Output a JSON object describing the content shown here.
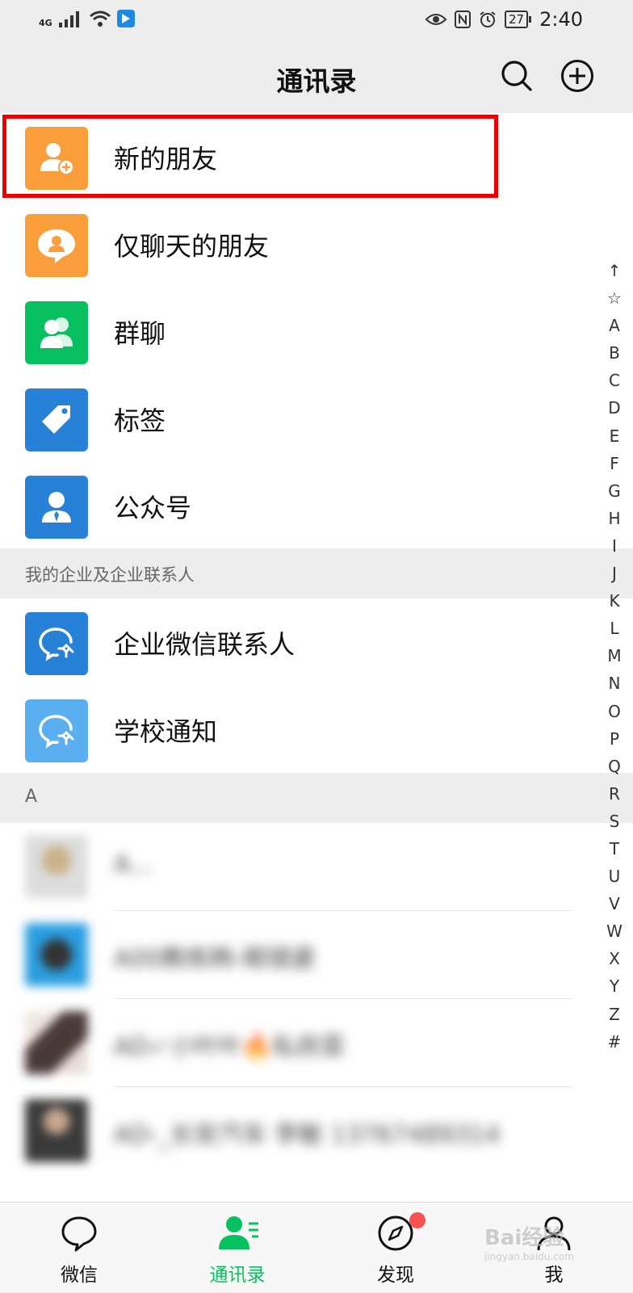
{
  "status_bar": {
    "network": "4G",
    "battery": "27",
    "time": "2:40"
  },
  "header": {
    "title": "通讯录"
  },
  "features": [
    {
      "label": "新的朋友",
      "color": "#fa9d3b",
      "icon": "add-friend-icon"
    },
    {
      "label": "仅聊天的朋友",
      "color": "#fa9d3b",
      "icon": "chat-only-friend-icon"
    },
    {
      "label": "群聊",
      "color": "#07c160",
      "icon": "group-chat-icon"
    },
    {
      "label": "标签",
      "color": "#2782d7",
      "icon": "tag-icon"
    },
    {
      "label": "公众号",
      "color": "#2782d7",
      "icon": "official-account-icon"
    }
  ],
  "enterprise_section": {
    "title": "我的企业及企业联系人",
    "items": [
      {
        "label": "企业微信联系人",
        "color": "#2782d7",
        "icon": "work-wechat-icon"
      },
      {
        "label": "学校通知",
        "color": "#5aaff0",
        "icon": "school-notice-icon"
      }
    ]
  },
  "contact_section": {
    "letter": "A",
    "contacts": [
      {
        "name": "A..."
      },
      {
        "name": "A00教练韩-眼镜婆"
      },
      {
        "name": "AD✓小叶叶🔥私房菜"
      },
      {
        "name": "AD-_长安汽车 李敏 13767489314"
      }
    ]
  },
  "index_bar": [
    "↑",
    "☆",
    "A",
    "B",
    "C",
    "D",
    "E",
    "F",
    "G",
    "H",
    "I",
    "J",
    "K",
    "L",
    "M",
    "N",
    "O",
    "P",
    "Q",
    "R",
    "S",
    "T",
    "U",
    "V",
    "W",
    "X",
    "Y",
    "Z",
    "#"
  ],
  "tabs": [
    {
      "label": "微信",
      "icon": "chat-bubble-icon",
      "active": false
    },
    {
      "label": "通讯录",
      "icon": "contacts-icon",
      "active": true
    },
    {
      "label": "发现",
      "icon": "compass-icon",
      "active": false,
      "badge_dot": true
    },
    {
      "label": "我",
      "icon": "person-icon",
      "active": false
    }
  ],
  "watermark": {
    "text": "Bai经验",
    "subtext": "jingyan.baidu.com"
  },
  "accent_color": "#07c160"
}
